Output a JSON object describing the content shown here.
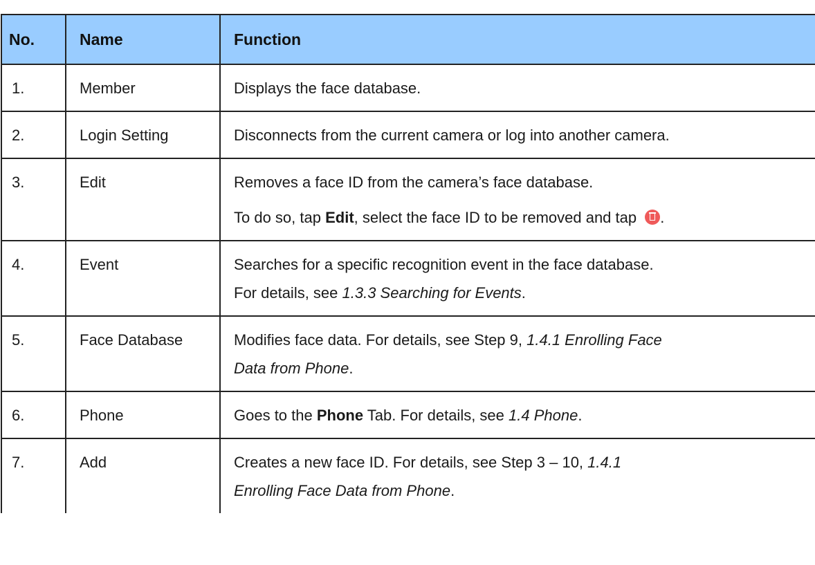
{
  "header": {
    "no": "No.",
    "name": "Name",
    "function": "Function"
  },
  "rows": [
    {
      "no": "1.",
      "name": "Member",
      "lines": [
        [
          "Displays the face database."
        ]
      ]
    },
    {
      "no": "2.",
      "name": "Login Setting",
      "lines": [
        [
          "Disconnects from the current camera or log into another camera."
        ]
      ]
    },
    {
      "no": "3.",
      "name": "Edit",
      "lines": [
        [
          "Removes a face ID from the camera’s face database."
        ],
        [
          "To do so, tap ",
          "Edit",
          ", select the face ID to be removed and tap ",
          "."
        ]
      ]
    },
    {
      "no": "4.",
      "name": "Event",
      "lines": [
        [
          "Searches for a specific recognition event in the face database."
        ],
        [
          "For details, see ",
          "1.3.3 Searching for Events",
          "."
        ]
      ]
    },
    {
      "no": "5.",
      "name": "Face Database",
      "lines": [
        [
          "Modifies face data. For details, see Step 9, ",
          "1.4.1 Enrolling Face"
        ],
        [
          "Data from Phone",
          "."
        ]
      ]
    },
    {
      "no": "6.",
      "name": "Phone",
      "lines": [
        [
          "Goes to the ",
          "Phone",
          " Tab. For details, see ",
          "1.4 Phone",
          "."
        ]
      ]
    },
    {
      "no": "7.",
      "name": "Add",
      "lines": [
        [
          "Creates a new face ID. For details, see Step 3 – 10, ",
          "1.4.1"
        ],
        [
          "Enrolling Face Data from Phone",
          "."
        ]
      ]
    }
  ],
  "icons": {
    "delete": "trash-icon",
    "delete_color": "#ef5a5a"
  },
  "colors": {
    "header_bg": "#99ccff",
    "border": "#222222"
  }
}
